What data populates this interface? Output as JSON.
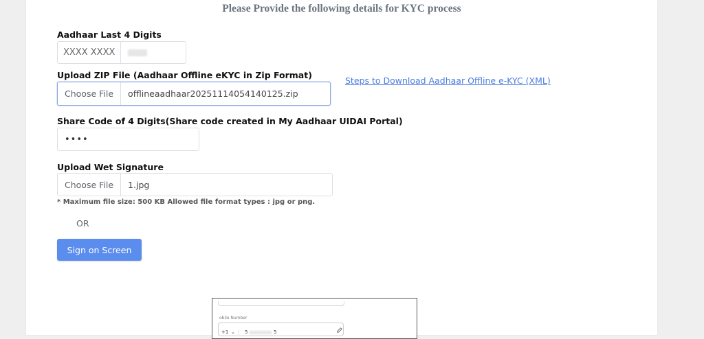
{
  "heading": "Please Provide the following details for KYC process",
  "aadhaar": {
    "label": "Aadhaar Last 4 Digits",
    "prefix": "XXXX XXXX"
  },
  "zip_upload": {
    "label": "Upload ZIP File (Aadhaar Offline eKYC in Zip Format)",
    "button": "Choose File",
    "file_name": "offlineaadhaar20251114054140125.zip",
    "help_link": "Steps to Download Aadhaar Offline e-KYC (XML)"
  },
  "share_code": {
    "label": "Share Code of 4 Digits(Share code created in My Aadhaar UIDAI Portal)",
    "value": "••••"
  },
  "signature": {
    "label": "Upload Wet Signature",
    "button": "Choose File",
    "file_name": "1.jpg",
    "note": "* Maximum file size: 500 KB Allowed file format types : jpg or png.",
    "or_text": "OR",
    "sign_button": "Sign on Screen"
  },
  "preview": {
    "field_label": "obile Number",
    "country_code": "+1",
    "chevron": "⌄",
    "number_start": "5",
    "number_end": "5"
  },
  "colors": {
    "primary": "#5b8def",
    "link": "#4a7be0",
    "heading": "#6b7480"
  }
}
